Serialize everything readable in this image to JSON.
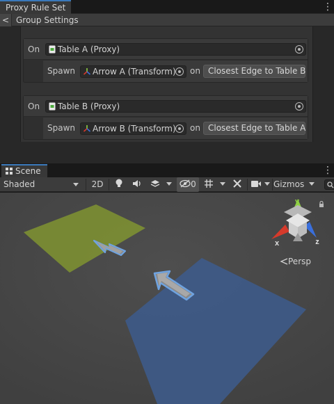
{
  "inspector": {
    "tab_title": "Proxy Rule Set",
    "back_label": "<",
    "breadcrumb": "Group Settings",
    "rules": [
      {
        "on_label": "On",
        "table_value": "Table A (Proxy)",
        "spawn_label": "Spawn",
        "arrow_value": "Arrow A (Transform)",
        "on_word": "on",
        "edge_button": "Closest Edge to Table B"
      },
      {
        "on_label": "On",
        "table_value": "Table B (Proxy)",
        "spawn_label": "Spawn",
        "arrow_value": "Arrow B (Transform)",
        "on_word": "on",
        "edge_button": "Closest Edge to Table A"
      }
    ]
  },
  "scene": {
    "tab_title": "Scene",
    "toolbar": {
      "shading_mode": "Shaded",
      "mode_2d": "2D",
      "hidden_count": "0",
      "gizmos_label": "Gizmos"
    },
    "gizmo_axes": {
      "y": "y",
      "x": "x",
      "z": "z"
    },
    "persp_label": "Persp",
    "colors": {
      "table_a": "#7a8c34",
      "table_b": "#3e5a86",
      "axis_x": "#d63a2b",
      "axis_y": "#8fd043",
      "axis_z": "#3a6fdc",
      "accent": "#3a79bb"
    }
  }
}
